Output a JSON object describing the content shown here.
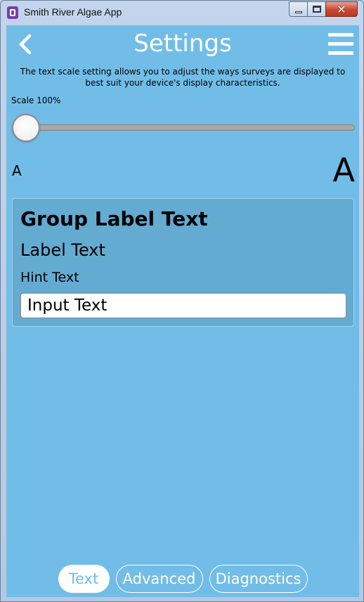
{
  "window": {
    "title": "Smith River Algae App",
    "close_glyph": "✕"
  },
  "header": {
    "title": "Settings"
  },
  "settings": {
    "description": "The text scale setting allows you to adjust the ways surveys are displayed to best suit your device's display characteristics.",
    "scale_label": "Scale 100%",
    "scale_value_percent": 100,
    "scale_position_fraction": 0.0,
    "small_sample": "A",
    "large_sample": "A"
  },
  "preview": {
    "group_label": "Group Label Text",
    "label": "Label Text",
    "hint": "Hint Text",
    "input_value": "Input Text"
  },
  "tabs": [
    {
      "label": "Text",
      "active": true
    },
    {
      "label": "Advanced",
      "active": false
    },
    {
      "label": "Diagnostics",
      "active": false
    }
  ],
  "colors": {
    "background": "#72bde8",
    "preview_panel": "#64abd2",
    "accent_text": "#ffffff"
  },
  "icons": {
    "back": "chevron-left-icon",
    "menu": "hamburger-menu-icon",
    "app": "app-icon"
  }
}
